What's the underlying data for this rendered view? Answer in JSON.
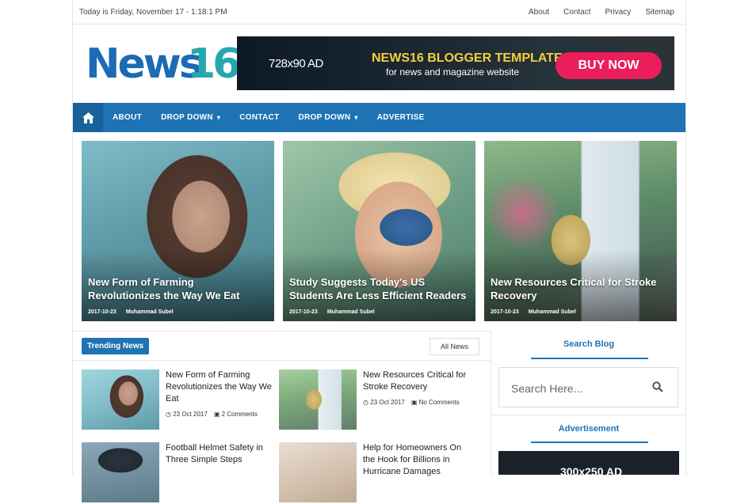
{
  "topbar": {
    "date": "Today is Friday, November 17 - 1:18:1 PM",
    "links": [
      "About",
      "Contact",
      "Privacy",
      "Sitemap"
    ]
  },
  "logo": {
    "news": "News",
    "num": "16"
  },
  "ad": {
    "size": "728x90 AD",
    "title": "NEWS16 BLOGGER TEMPLATE",
    "subtitle": "for news and magazine website",
    "button": "BUY NOW"
  },
  "nav": {
    "items": [
      "ABOUT",
      "DROP DOWN",
      "CONTACT",
      "DROP DOWN",
      "ADVERTISE"
    ]
  },
  "featured": [
    {
      "title": "New Form of Farming Revolutionizes the Way We Eat",
      "date": "2017-10-23",
      "author": "Muhammad Subel"
    },
    {
      "title": "Study Suggests Today's US Students Are Less Efficient Readers",
      "date": "2017-10-23",
      "author": "Muhammad Subel"
    },
    {
      "title": "New Resources Critical for Stroke Recovery",
      "date": "2017-10-23",
      "author": "Muhammad Subel"
    }
  ],
  "trending": {
    "label": "Trending News",
    "all": "All News",
    "posts": [
      {
        "title": "New Form of Farming Revolutionizes the Way We Eat",
        "date": "23 Oct 2017",
        "comments": "2 Comments"
      },
      {
        "title": "New Resources Critical for Stroke Recovery",
        "date": "23 Oct 2017",
        "comments": "No Comments"
      },
      {
        "title": "Football Helmet Safety in Three Simple Steps",
        "date": "",
        "comments": ""
      },
      {
        "title": "Help for Homeowners On the Hook for Billions in Hurricane Damages",
        "date": "",
        "comments": ""
      }
    ]
  },
  "sidebar": {
    "search_title": "Search Blog",
    "search_placeholder": "Search Here...",
    "ad_title": "Advertisement",
    "ad_text": "300x250 AD"
  },
  "colors": {
    "accent": "#1e73b5",
    "buy": "#e91e5a",
    "adTitle": "#f3d03b"
  }
}
